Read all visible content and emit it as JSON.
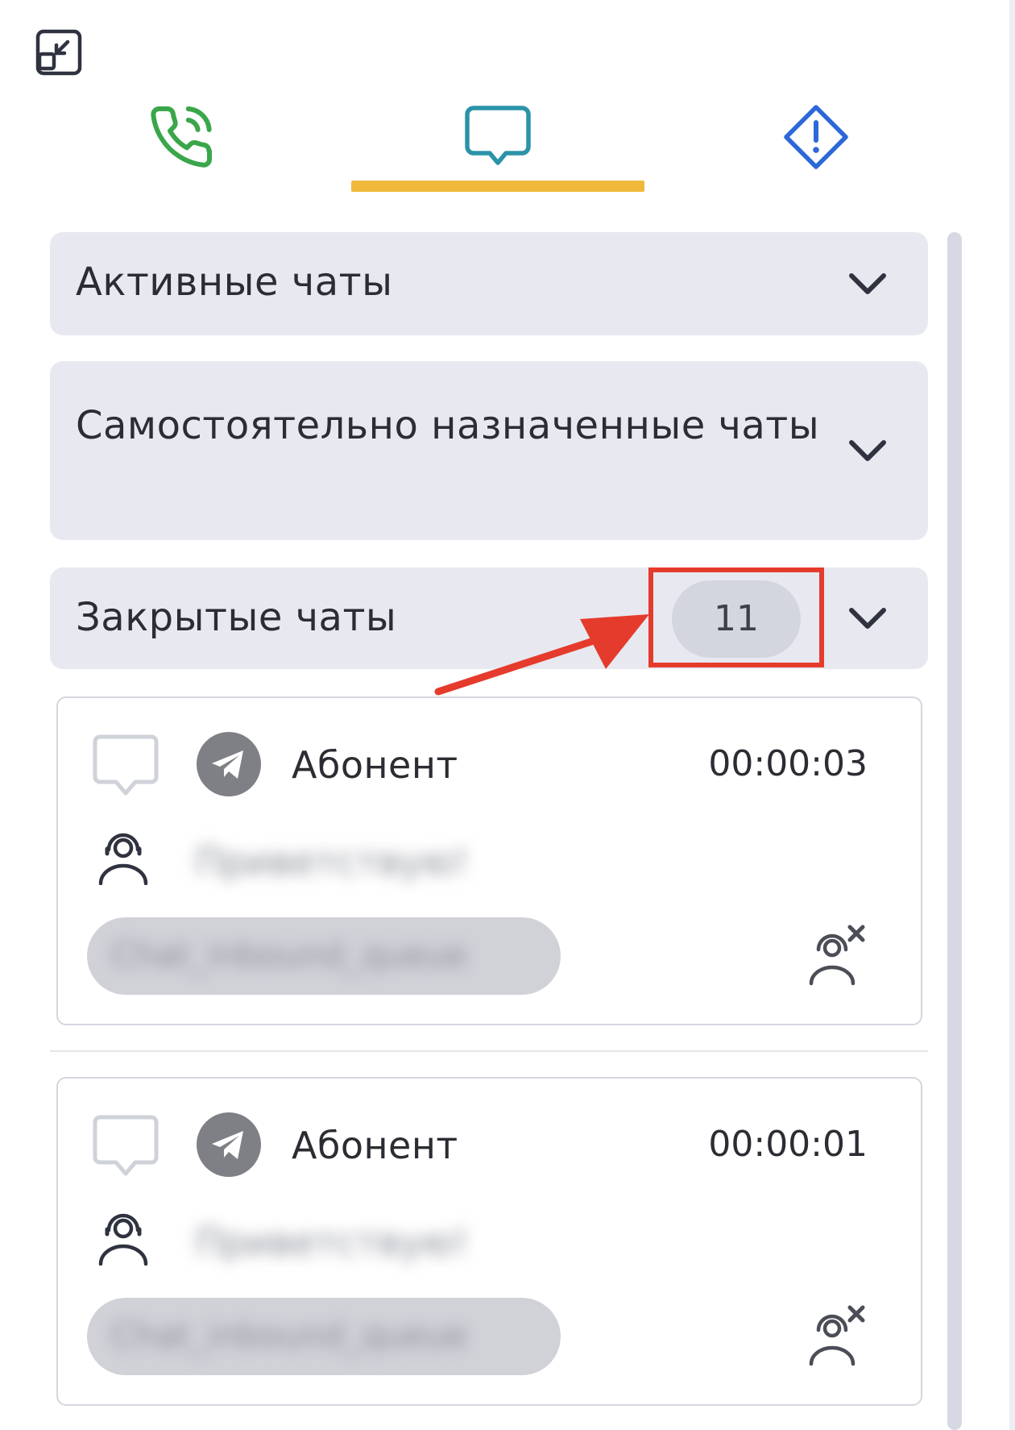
{
  "colors": {
    "accent_underline": "#f0b93b",
    "phone_green": "#3aa64a",
    "chat_teal": "#2b93a8",
    "alert_blue": "#2c68d8",
    "section_bg": "#e8e9f0",
    "highlight_red": "#e53b2c"
  },
  "toolbar": {
    "minimize_icon": "minimize-window-icon"
  },
  "tabs": [
    {
      "icon": "phone-icon",
      "active": false
    },
    {
      "icon": "chat-bubble-icon",
      "active": true
    },
    {
      "icon": "alert-diamond-icon",
      "active": false
    }
  ],
  "sections": {
    "active": {
      "title": "Активные чаты"
    },
    "self_assigned": {
      "title": "Самостоятельно назначенные чаты"
    },
    "closed": {
      "title": "Закрытые чаты",
      "count": "11"
    }
  },
  "chats": [
    {
      "subscriber": "Абонент",
      "duration": "00:00:03",
      "channel_icon": "telegram-icon",
      "last_message": "Приветствую!",
      "queue": "Chat_inbound_queue"
    },
    {
      "subscriber": "Абонент",
      "duration": "00:00:01",
      "channel_icon": "telegram-icon",
      "last_message": "Приветствую!",
      "queue": "Chat_inbound_queue"
    }
  ]
}
